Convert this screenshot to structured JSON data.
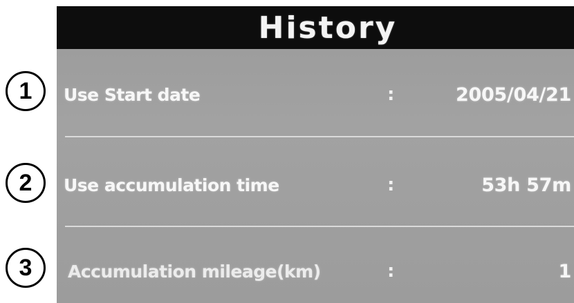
{
  "callouts": [
    "1",
    "2",
    "3"
  ],
  "screen": {
    "title": "History",
    "rows": [
      {
        "label": "Use Start date",
        "separator": ":",
        "value": "2005/04/21"
      },
      {
        "label": "Use accumulation time",
        "separator": ":",
        "value": "53h 57m"
      },
      {
        "label": "Accumulation mileage(km)",
        "separator": ":",
        "value": "1"
      }
    ]
  },
  "colors": {
    "title_bar": "#0d0d0d",
    "screen_background": "#a0a0a0",
    "text": "#f7f7f7"
  }
}
